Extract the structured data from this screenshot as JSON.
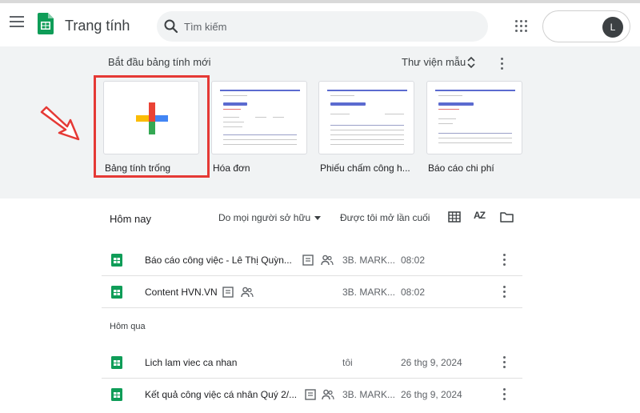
{
  "header": {
    "app_title": "Trang tính",
    "search_placeholder": "Tìm kiếm",
    "avatar_letter": "L"
  },
  "gallery": {
    "title": "Bắt đầu bảng tính mới",
    "library_label": "Thư viện mẫu",
    "templates": [
      {
        "label": "Bảng tính trống"
      },
      {
        "label": "Hóa đơn"
      },
      {
        "label": "Phiếu chấm công h..."
      },
      {
        "label": "Báo cáo chi phí"
      }
    ]
  },
  "files": {
    "section_title": "Hôm nay",
    "owner_filter": "Do mọi người sở hữu",
    "sort_label": "Được tôi mở lần cuối",
    "az_label": "AZ",
    "yesterday_label": "Hôm qua",
    "rows": [
      {
        "name": "Báo cáo công việc - Lê Thị Quỳn...",
        "owner": "3B. MARK...",
        "opened": "08:02"
      },
      {
        "name": "Content HVN.VN",
        "owner": "3B. MARK...",
        "opened": "08:02"
      },
      {
        "name": "Lich lam viec ca nhan",
        "owner": "tôi",
        "opened": "26 thg 9, 2024"
      },
      {
        "name": "Kết quả công việc cá nhân Quý 2/...",
        "owner": "3B. MARK...",
        "opened": "26 thg 9, 2024"
      }
    ]
  },
  "colors": {
    "sheets_green": "#0f9d58",
    "highlight_red": "#e53935",
    "plus_red": "#ea4335",
    "plus_blue": "#4285f4",
    "plus_yellow": "#fbbc04",
    "plus_green": "#34a853"
  }
}
